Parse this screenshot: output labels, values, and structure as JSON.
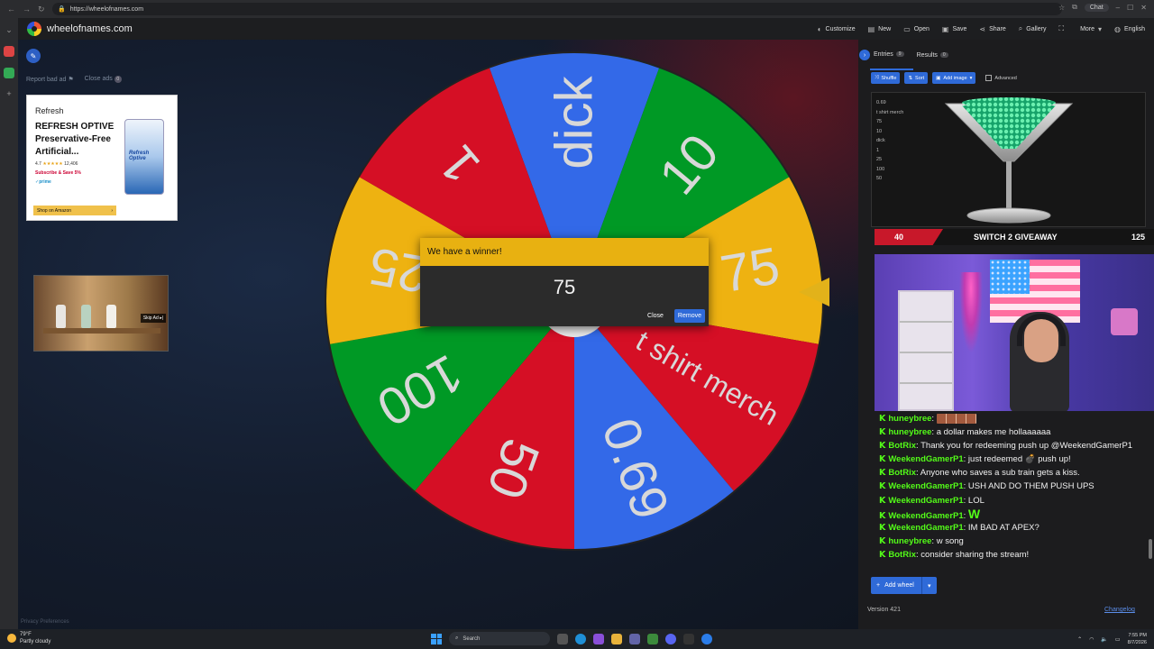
{
  "browser": {
    "url": "https://wheelofnames.com",
    "profile_label": "Chat"
  },
  "header": {
    "site_name": "wheelofnames.com",
    "menu": [
      {
        "label": "Customize",
        "icon": "palette-icon"
      },
      {
        "label": "New",
        "icon": "new-file-icon"
      },
      {
        "label": "Open",
        "icon": "folder-icon"
      },
      {
        "label": "Save",
        "icon": "save-icon"
      },
      {
        "label": "Share",
        "icon": "share-icon"
      },
      {
        "label": "Gallery",
        "icon": "search-icon"
      },
      {
        "label": "",
        "icon": "fullscreen-icon"
      },
      {
        "label": "More",
        "icon": "chevron-down-icon"
      },
      {
        "label": "English",
        "icon": "globe-icon"
      }
    ]
  },
  "stage": {
    "report_ad": "Report bad ad",
    "close_ads": "Close ads",
    "close_ads_count": "0",
    "privacy": "Privacy Preferences",
    "ad": {
      "brand": "Refresh",
      "title": "REFRESH OPTIVE Preservative-Free Artificial...",
      "rating": "4.7",
      "stars": "★★★★★",
      "reviews": "12,406",
      "subscribe": "Subscribe & Save 5%",
      "prime": "✓prime",
      "cta": "Shop on Amazon",
      "product_label": "Refresh Optive"
    },
    "video_ad": {
      "skip": "Skip Ad ▸|"
    }
  },
  "wheel": {
    "segments": [
      {
        "label": "dick",
        "color": "#3369e8"
      },
      {
        "label": "10",
        "color": "#009925"
      },
      {
        "label": "75",
        "color": "#eeb211"
      },
      {
        "label": "t shirt merch",
        "color": "#d50f25"
      },
      {
        "label": "0.69",
        "color": "#3369e8"
      },
      {
        "label": "50",
        "color": "#d50f25"
      },
      {
        "label": "100",
        "color": "#009925"
      },
      {
        "label": "25",
        "color": "#eeb211"
      },
      {
        "label": "1",
        "color": "#d50f25"
      }
    ]
  },
  "winner": {
    "heading": "We have a winner!",
    "value": "75",
    "close": "Close",
    "remove": "Remove"
  },
  "panel": {
    "tabs": [
      {
        "label": "Entries",
        "count": "9"
      },
      {
        "label": "Results",
        "count": "0"
      }
    ],
    "toolbar": {
      "shuffle": "Shuffle",
      "sort": "Sort",
      "add_image": "Add image",
      "advanced": "Advanced"
    },
    "entries": [
      "0.69",
      "t shirt merch",
      "75",
      "10",
      "dick",
      "1",
      "25",
      "100",
      "50"
    ],
    "add_wheel": "Add wheel",
    "version": "Version 421",
    "changelog": "Changelog"
  },
  "stream_overlay": {
    "left_count": "40",
    "title": "SWITCH 2 GIVEAWAY",
    "right_count": "125"
  },
  "chat": [
    {
      "user": "huneybree",
      "msg": "",
      "emote": "strip"
    },
    {
      "user": "huneybree",
      "msg": "a dollar makes me hollaaaaaa"
    },
    {
      "user": "BotRix",
      "msg": "Thank you for redeeming push up @WeekendGamerP1"
    },
    {
      "user": "WeekendGamerP1",
      "msg": "just redeemed 💣 push up!"
    },
    {
      "user": "BotRix",
      "msg": "Anyone who saves a sub train gets a kiss."
    },
    {
      "user": "WeekendGamerP1",
      "msg": "USH AND DO THEM PUSH UPS"
    },
    {
      "user": "WeekendGamerP1",
      "msg": "LOL"
    },
    {
      "user": "WeekendGamerP1",
      "msg": "",
      "emote": "W"
    },
    {
      "user": "WeekendGamerP1",
      "msg": "IM BAD AT APEX?"
    },
    {
      "user": "huneybree",
      "msg": "w song"
    },
    {
      "user": "BotRix",
      "msg": "consider sharing the stream!"
    }
  ],
  "taskbar": {
    "temp": "79°F",
    "weather": "Partly cloudy",
    "search": "Search",
    "time": "7:55 PM",
    "date": "8/7/2026"
  }
}
